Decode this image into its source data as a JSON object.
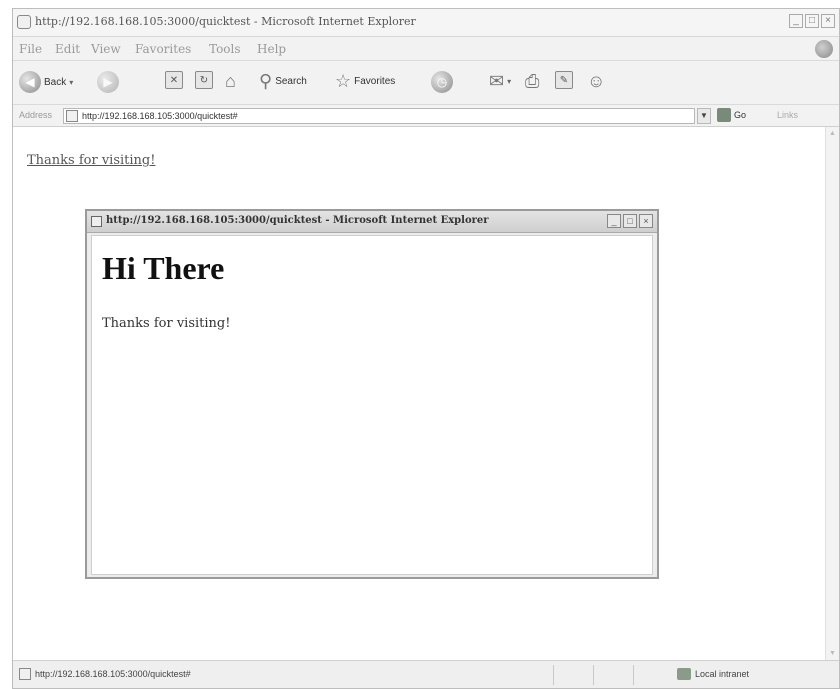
{
  "window": {
    "title": "http://192.168.168.105:3000/quickt​est - Microsoft Internet Explorer",
    "controls": [
      "_",
      "□",
      "×"
    ]
  },
  "menu": {
    "items": [
      "File",
      "Edit",
      "View",
      "Favorites",
      "Tools",
      "Help"
    ]
  },
  "toolbar": {
    "back_label": "Back",
    "search_label": "Search",
    "favorites_label": "Favorites"
  },
  "address": {
    "label": "Address",
    "url": "http://192.168.168.105:3000/quicktest#",
    "go_label": "Go",
    "links_label": "Links"
  },
  "page": {
    "link_text": "Thanks for visiting!"
  },
  "popup": {
    "title": "http://192.168.168.105:3000/quicktest - Microsoft Internet Explorer",
    "heading": "Hi There",
    "body_text": "Thanks for visiting!"
  },
  "status": {
    "url": "http://192.168.168.105:3000/quicktest#",
    "zone": "Local intranet"
  }
}
